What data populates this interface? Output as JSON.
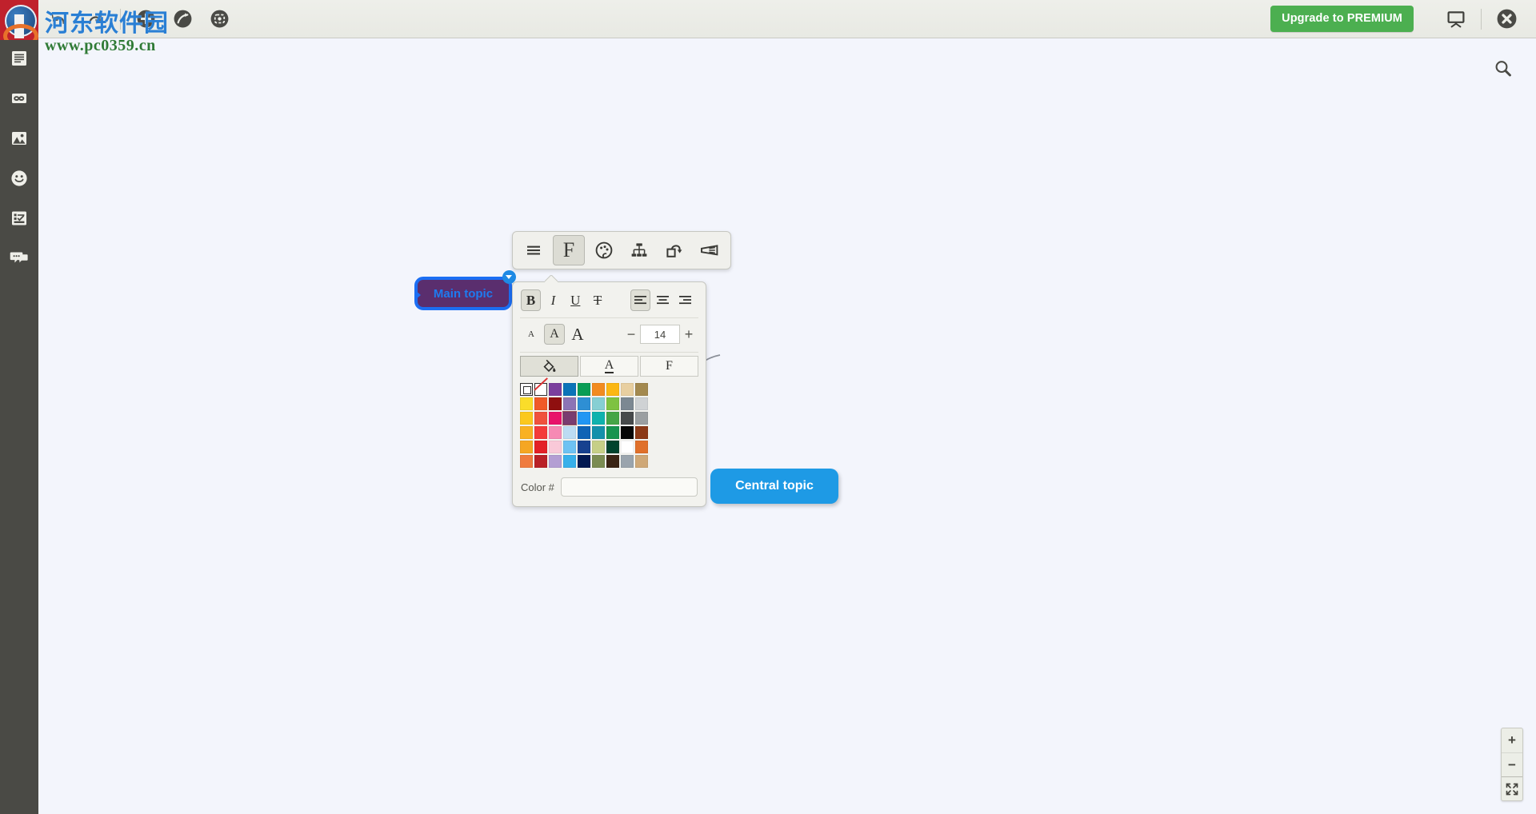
{
  "watermark": {
    "cn": "河东软件园",
    "url": "www.pc0359.cn"
  },
  "topbar": {
    "buttons": [
      {
        "name": "undo-icon",
        "label": "Undo"
      },
      {
        "name": "redo-icon",
        "label": "Redo"
      },
      {
        "name": "add-topic-icon",
        "label": "Add topic"
      },
      {
        "name": "add-relation-icon",
        "label": "Add relationship"
      },
      {
        "name": "add-boundary-icon",
        "label": "Add boundary"
      }
    ],
    "premium_label": "Upgrade to PREMIUM",
    "presentation_label": "Presentation mode",
    "close_label": "Close"
  },
  "sidebar": {
    "items": [
      {
        "label": "Notes",
        "icon": "notes-icon"
      },
      {
        "label": "Link",
        "icon": "link-icon"
      },
      {
        "label": "Image",
        "icon": "image-icon"
      },
      {
        "label": "Emoji",
        "icon": "smiley-icon"
      },
      {
        "label": "Task",
        "icon": "task-icon"
      },
      {
        "label": "Comment",
        "icon": "comment-icon"
      }
    ]
  },
  "canvas": {
    "search_label": "Search",
    "nodes": [
      {
        "id": "central",
        "label": "Central topic",
        "fill": "#1e9ae5",
        "text": "#ffffff"
      },
      {
        "id": "main",
        "label": "Main topic",
        "fill": "#5a2e6e",
        "text": "#1e7bf0",
        "border": "#1b6ef3"
      }
    ]
  },
  "format_toolbar": {
    "items": [
      {
        "name": "menu-icon",
        "label": "Menu",
        "active": false
      },
      {
        "name": "font-icon",
        "label": "Font",
        "active": true,
        "glyph": "F"
      },
      {
        "name": "palette-icon",
        "label": "Style",
        "active": false
      },
      {
        "name": "hierarchy-icon",
        "label": "Structure",
        "active": false
      },
      {
        "name": "shape-icon",
        "label": "Shape",
        "active": false
      },
      {
        "name": "boundary-icon",
        "label": "Boundary",
        "active": false
      }
    ]
  },
  "format_panel": {
    "text_styles": [
      {
        "name": "bold-button",
        "glyph": "B",
        "active": true
      },
      {
        "name": "italic-button",
        "glyph": "I",
        "active": false
      },
      {
        "name": "underline-button",
        "glyph": "U",
        "active": false
      },
      {
        "name": "strikethrough-button",
        "glyph": "T",
        "active": false
      }
    ],
    "alignments": [
      {
        "name": "align-left-button",
        "active": true
      },
      {
        "name": "align-center-button",
        "active": false
      },
      {
        "name": "align-right-button",
        "active": false
      }
    ],
    "size_presets": [
      {
        "name": "font-size-small-button",
        "glyph": "A",
        "size": "11px",
        "active": false
      },
      {
        "name": "font-size-medium-button",
        "glyph": "A",
        "size": "16px",
        "active": true
      },
      {
        "name": "font-size-large-button",
        "glyph": "A",
        "size": "21px",
        "active": false
      }
    ],
    "stepper": {
      "minus": "−",
      "plus": "+",
      "value": "14",
      "placeholder": "14"
    },
    "tabs": [
      {
        "name": "tab-fill-color",
        "label": "Fill color",
        "glyph": "",
        "active": true
      },
      {
        "name": "tab-text-color",
        "label": "Text color",
        "glyph": "A",
        "active": false
      },
      {
        "name": "tab-font-family",
        "label": "Font family",
        "glyph": "F",
        "active": false
      }
    ],
    "color_hash_label": "Color #",
    "color_hash_value": "",
    "color_hash_placeholder": "",
    "palette": {
      "row0": [
        "default",
        "none",
        "#7b3f9d",
        "#0b73b8",
        "#0a9d55",
        "#f28b20",
        "#fbb713",
        "#e8cfa0",
        "#a3894f"
      ],
      "rows": [
        [
          "#fadd2a",
          "#f05a28",
          "#8f0f0f",
          "#8c74b5",
          "#2e8fd4",
          "#86cfd3",
          "#7ec242",
          "#7c8892",
          "#cfd2d4"
        ],
        [
          "#fbc81e",
          "#f0513d",
          "#e8136a",
          "#7a3c70",
          "#2196f3",
          "#0fb2ae",
          "#46a547",
          "#474a4b",
          "#9b9fa1"
        ],
        [
          "#f9b122",
          "#f43a3a",
          "#f68ab4",
          "#bcdcf3",
          "#0f63b5",
          "#1490ab",
          "#17944f",
          "#060606",
          "#8c3a17"
        ],
        [
          "#f5a623",
          "#e32027",
          "#f9c9d8",
          "#6ec2f2",
          "#17418f",
          "#c6cf87",
          "#01432d",
          "#ffffff",
          "#e0702a"
        ],
        [
          "#ef7b3e",
          "#b92026",
          "#b39ed3",
          "#38b0ea",
          "#031a52",
          "#7b8c52",
          "#3a2414",
          "#9aa4ad",
          "#cfa877"
        ]
      ]
    }
  },
  "zoom_controls": {
    "zoom_in": "+",
    "zoom_out": "−",
    "fit_label": "Fit to screen"
  }
}
